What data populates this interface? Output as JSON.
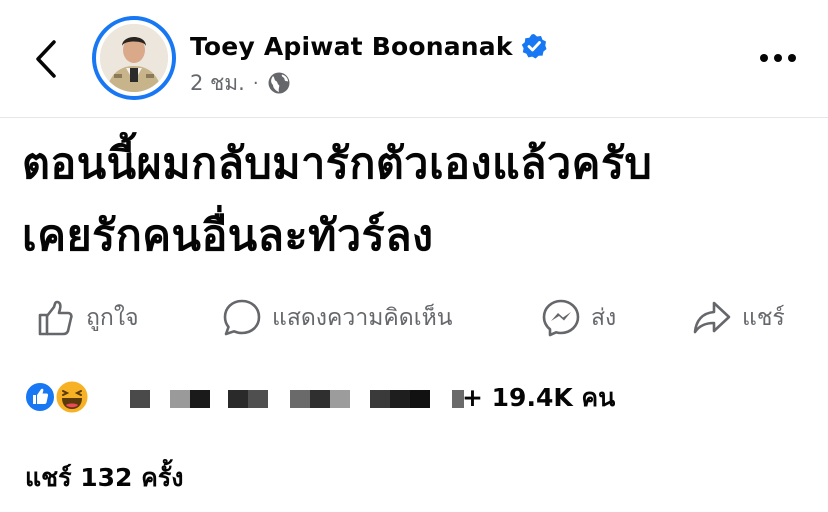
{
  "header": {
    "back_icon": "chevron-left-icon",
    "author_name": "Toey Apiwat Boonanak",
    "verified_icon": "verified-badge-icon",
    "timestamp": "2 ชม.",
    "separator": "·",
    "privacy_icon": "globe-icon",
    "more_icon": "more-horizontal-icon"
  },
  "post": {
    "text": "ตอนนี้ผมกลับมารักตัวเองแล้วครับ\nเคยรักคนอื่นละทัวร์ลง"
  },
  "actions": [
    {
      "label": "ถูกใจ",
      "icon": "thumbs-up-icon"
    },
    {
      "label": "แสดงความคิดเห็น",
      "icon": "comment-bubble-icon"
    },
    {
      "label": "ส่ง",
      "icon": "messenger-icon"
    },
    {
      "label": "แชร์",
      "icon": "share-arrow-icon"
    }
  ],
  "reactions": {
    "icons": [
      "like-reaction-icon",
      "haha-reaction-icon"
    ],
    "count_text": "+ 19.4K คน"
  },
  "shares": {
    "text": "แชร์ 132 ครั้ง"
  },
  "colors": {
    "accent": "#1877f2",
    "secondary_text": "#65676b",
    "primary_text": "#050505",
    "haha": "#f7b125"
  }
}
